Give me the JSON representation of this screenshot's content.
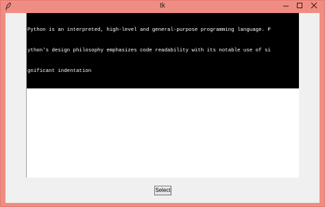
{
  "window": {
    "title": "tk",
    "app_icon": "feather-icon",
    "controls": {
      "minimize_icon": "minimize-icon",
      "maximize_icon": "maximize-icon",
      "close_icon": "close-icon"
    },
    "frame_color": "#f08d82"
  },
  "textbox": {
    "lines": [
      "Python is an interpreted, high-level and general-purpose programming language. P",
      "ython's design philosophy emphasizes code readability with its notable use of si",
      "gnificant indentation"
    ],
    "selection_background": "#000000",
    "selection_foreground": "#ffffff"
  },
  "buttons": {
    "select_label": "Select"
  }
}
